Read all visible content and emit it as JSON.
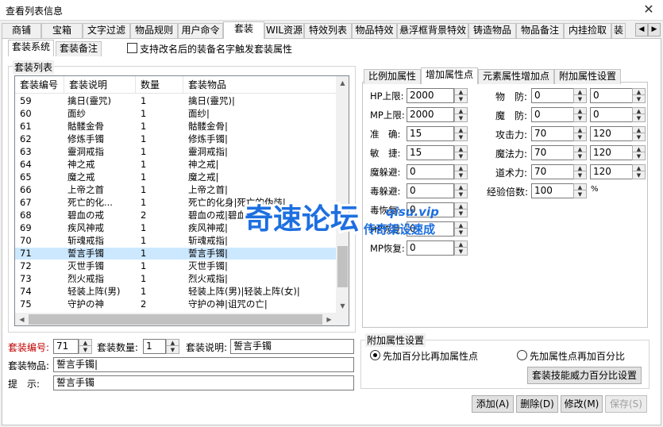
{
  "window": {
    "title": "查看列表信息",
    "close_glyph": "✕"
  },
  "tabs": [
    "商铺",
    "宝箱",
    "文字过滤",
    "物品规则",
    "用户命令",
    "套装",
    "WIL资源",
    "特效列表",
    "物品特效",
    "悬浮框背景特效",
    "铸造物品",
    "物品备注",
    "内挂捡取",
    "装"
  ],
  "active_tab": "套装",
  "subtabs": {
    "system": "套装系统",
    "note": "套装备注"
  },
  "rename_checkbox_label": "支持改名后的装备名字触发套装属性",
  "list_group_label": "套装列表",
  "list_columns": [
    "套装编号",
    "套装说明",
    "数量",
    "套装物品"
  ],
  "list_rows": [
    {
      "id": "59",
      "desc": "擒日(靈咒)",
      "qty": "1",
      "items": "擒日(靈咒)|"
    },
    {
      "id": "60",
      "desc": "面纱",
      "qty": "1",
      "items": "面纱|"
    },
    {
      "id": "61",
      "desc": "骷髅金骨",
      "qty": "1",
      "items": "骷髅金骨|"
    },
    {
      "id": "62",
      "desc": "修炼手镯",
      "qty": "1",
      "items": "修炼手镯|"
    },
    {
      "id": "63",
      "desc": "靈洞戒指",
      "qty": "1",
      "items": "靈洞戒指|"
    },
    {
      "id": "64",
      "desc": "神之戒",
      "qty": "1",
      "items": "神之戒|"
    },
    {
      "id": "65",
      "desc": "魔之戒",
      "qty": "1",
      "items": "魔之戒|"
    },
    {
      "id": "66",
      "desc": "上帝之首",
      "qty": "1",
      "items": "上帝之首|"
    },
    {
      "id": "67",
      "desc": "死亡的化...",
      "qty": "1",
      "items": "死亡的化身|死亡的伪装|"
    },
    {
      "id": "68",
      "desc": "碧血の戒",
      "qty": "2",
      "items": "碧血の戒|碧血の..."
    },
    {
      "id": "69",
      "desc": "疾风神戒",
      "qty": "1",
      "items": "疾风神戒|"
    },
    {
      "id": "70",
      "desc": "斩魂戒指",
      "qty": "1",
      "items": "斩魂戒指|"
    },
    {
      "id": "71",
      "desc": "誓言手镯",
      "qty": "1",
      "items": "誓言手镯|"
    },
    {
      "id": "72",
      "desc": "灭世手镯",
      "qty": "1",
      "items": "灭世手镯|"
    },
    {
      "id": "73",
      "desc": "烈火戒指",
      "qty": "1",
      "items": "烈火戒指|"
    },
    {
      "id": "74",
      "desc": "轻装上阵(男)",
      "qty": "1",
      "items": "轻装上阵(男)|轻装上阵(女)|"
    },
    {
      "id": "75",
      "desc": "守护の神",
      "qty": "2",
      "items": "守护の神|诅咒の亡|"
    }
  ],
  "selected_row": 12,
  "vertical_scroll_position": 0.93,
  "editor": {
    "id_label": "套装编号:",
    "id_value": "71",
    "count_label": "套装数量:",
    "count_value": "1",
    "desc_label": "套装说明:",
    "desc_value": "誓言手镯",
    "items_label": "套装物品:",
    "items_value": "誓言手镯|",
    "hint_label": "提　示:",
    "hint_value": "誓言手镯"
  },
  "attr_tabs": [
    "比例加属性",
    "增加属性点",
    "元素属性增加点",
    "附加属性设置"
  ],
  "active_attr_tab": "增加属性点",
  "attr_left": [
    {
      "label": "HP上限:",
      "value": "2000"
    },
    {
      "label": "MP上限:",
      "value": "2000"
    },
    {
      "label": "准　确:",
      "value": "15"
    },
    {
      "label": "敏　捷:",
      "value": "15"
    },
    {
      "label": "魔躲避:",
      "value": "0"
    },
    {
      "label": "毒躲避:",
      "value": "0"
    },
    {
      "label": "毒恢复:",
      "value": "0"
    },
    {
      "label": "HP恢复:",
      "value": "0"
    },
    {
      "label": "MP恢复:",
      "value": "0"
    }
  ],
  "attr_right": [
    {
      "label": "物　防:",
      "min": "0",
      "max": "0"
    },
    {
      "label": "魔　防:",
      "min": "0",
      "max": "0"
    },
    {
      "label": "攻击力:",
      "min": "70",
      "max": "120"
    },
    {
      "label": "魔法力:",
      "min": "70",
      "max": "120"
    },
    {
      "label": "道术力:",
      "min": "70",
      "max": "120"
    }
  ],
  "exp_multiplier": {
    "label": "经验倍数:",
    "value": "100",
    "unit": "%"
  },
  "extra_group": {
    "label": "附加属性设置",
    "option_percent_first": "先加百分比再加属性点",
    "option_points_first": "先加属性点再加百分比",
    "selected": "option_percent_first",
    "skill_button": "套装技能威力百分比设置"
  },
  "buttons": {
    "add": "添加(A)",
    "delete": "删除(D)",
    "modify": "修改(M)",
    "save": "保存(S)"
  },
  "watermark": {
    "main": "奇速论坛",
    "site": "qisu.vip",
    "slogan": "传奇架设速成"
  },
  "colors": {
    "accent": "#1d6fe0",
    "selection": "#cce8ff",
    "id_label": "#c00000"
  }
}
